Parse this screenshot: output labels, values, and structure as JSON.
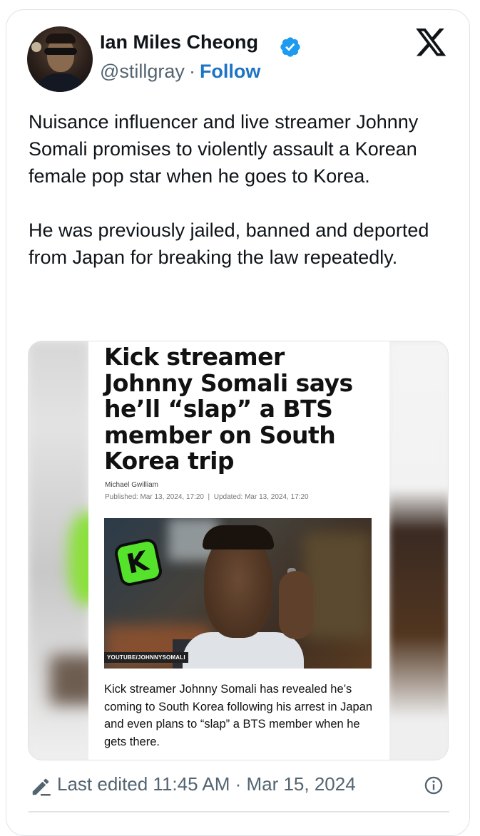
{
  "user": {
    "name": "Ian Miles Cheong",
    "handle": "@stillgray",
    "separator": "·",
    "follow_label": "Follow"
  },
  "icons": {
    "verified": "verified-badge-icon",
    "logo": "x-logo-icon",
    "edit": "pencil-icon",
    "info": "info-icon"
  },
  "colors": {
    "accent": "#1d73c4",
    "verified": "#1d9bf0",
    "muted": "#536471",
    "kick_green": "#55e22b"
  },
  "tweet": {
    "paragraphs": [
      "Nuisance influencer and live streamer Johnny Somali promises to violently assault a Korean female pop star when he goes to Korea.",
      "He was previously jailed, banned and deported from Japan for breaking the law repeatedly."
    ]
  },
  "media": {
    "headline": "Kick streamer Johnny Somali says he’ll “slap” a BTS member on South Korea trip",
    "author": "Michael Gwilliam",
    "published": "Published: Mar 13, 2024, 17:20",
    "separator": "|",
    "updated": "Updated: Mar 13, 2024, 17:20",
    "logo_letter": "K",
    "photo_credit": "YOUTUBE/JOHNNYSOMALI",
    "lede": "Kick streamer Johnny Somali has revealed he’s coming to South Korea following his arrest in Japan and even plans to “slap” a BTS member when he gets there."
  },
  "meta": {
    "edited_label": "Last edited 11:45 AM · Mar 15, 2024"
  }
}
